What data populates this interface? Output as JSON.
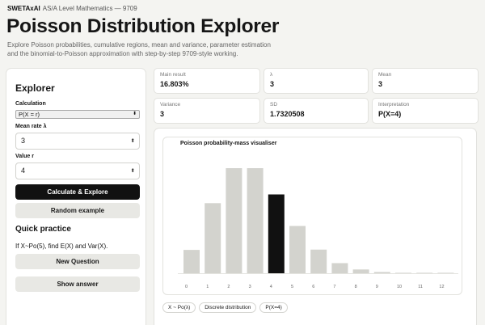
{
  "brand": {
    "name": "SWETAxAI",
    "subtitle": "AS/A Level Mathematics — 9709"
  },
  "header": {
    "title": "Poisson Distribution Explorer",
    "description": "Explore Poisson probabilities, cumulative regions, mean and variance, parameter estimation and the binomial-to-Poisson approximation with step-by-step 9709-style working."
  },
  "explorer": {
    "title": "Explorer",
    "calculation_label": "Calculation",
    "calculation_value": "P(X = r)",
    "lambda_label": "Mean rate λ",
    "lambda_value": "3",
    "r_label": "Value r",
    "r_value": "4",
    "calculate_label": "Calculate & Explore",
    "random_label": "Random example"
  },
  "practice": {
    "title": "Quick practice",
    "question": "If X~Po(5), find E(X) and Var(X).",
    "new_label": "New Question",
    "show_label": "Show answer"
  },
  "results": {
    "main": {
      "key": "Main result",
      "value": "16.803%"
    },
    "lambda": {
      "key": "λ",
      "value": "3"
    },
    "mean": {
      "key": "Mean",
      "value": "3"
    },
    "variance": {
      "key": "Variance",
      "value": "3"
    },
    "sd": {
      "key": "SD",
      "value": "1.7320508"
    },
    "interp": {
      "key": "Interpretation",
      "value": "P(X=4)"
    }
  },
  "tags": [
    "X ~ Po(λ)",
    "Discrete distribution",
    "P(X=4)"
  ],
  "colors": {
    "bar": "#d3d3ce",
    "highlight": "#111111",
    "axis": "#e4e4e0"
  },
  "chart_data": {
    "type": "bar",
    "title": "Poisson probability-mass visualiser",
    "categories": [
      "0",
      "1",
      "2",
      "3",
      "4",
      "5",
      "6",
      "7",
      "8",
      "9",
      "10",
      "11",
      "12"
    ],
    "values": [
      0.0498,
      0.1494,
      0.224,
      0.224,
      0.168,
      0.1008,
      0.0504,
      0.0216,
      0.0081,
      0.0027,
      0.0008,
      0.0002,
      0.0001
    ],
    "highlight_index": 4,
    "xlabel": "",
    "ylabel": "",
    "ylim": [
      0,
      0.224
    ],
    "grid": false
  }
}
